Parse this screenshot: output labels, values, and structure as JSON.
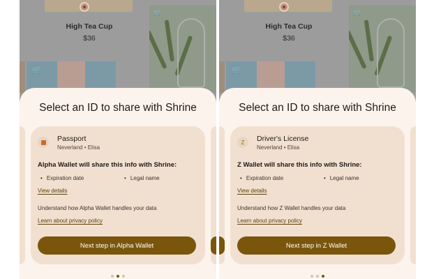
{
  "screens": [
    {
      "product_name": "High Tea Cup",
      "product_price": "$36",
      "sheet_title": "Select an ID to share with Shrine",
      "credential_name": "Passport",
      "credential_sub": "Neverland • Elisa",
      "credential_icon": "passport-icon",
      "share_heading": "Alpha Wallet will share this info with Shrine:",
      "attributes": [
        "Expiration date",
        "Legal name"
      ],
      "view_details": "View details",
      "handling_text": "Understand how Alpha Wallet handles your data",
      "privacy_link": "Learn about privacy policy",
      "next_button": "Next step in Alpha Wallet",
      "active_dot": 1
    },
    {
      "product_name": "High Tea Cup",
      "product_price": "$36",
      "sheet_title": "Select an ID to share with Shrine",
      "credential_name": "Driver's License",
      "credential_sub": "Neverland • Elisa",
      "credential_icon": "z-wallet-icon",
      "credential_icon_letter": "Z",
      "share_heading": "Z Wallet will share this info with Shrine:",
      "attributes": [
        "Expiration date",
        "Legal name"
      ],
      "view_details": "View details",
      "handling_text": "Understand how Z Wallet handles your data",
      "privacy_link": "Learn about privacy policy",
      "next_button": "Next step in Z Wallet",
      "active_dot": 2
    }
  ],
  "colors": {
    "accent": "#7a560c",
    "sheet_background": "#fcf3ec",
    "card_background": "#f1e0d0",
    "scrim": "#9c9c9c"
  }
}
